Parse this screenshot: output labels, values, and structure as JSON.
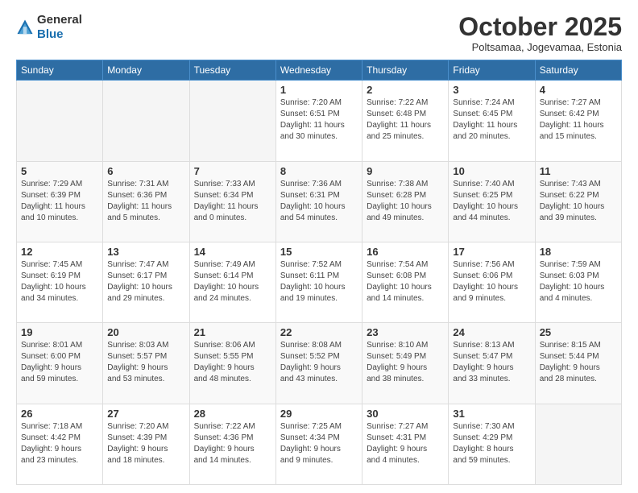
{
  "header": {
    "logo_general": "General",
    "logo_blue": "Blue",
    "month": "October 2025",
    "location": "Poltsamaa, Jogevamaa, Estonia"
  },
  "weekdays": [
    "Sunday",
    "Monday",
    "Tuesday",
    "Wednesday",
    "Thursday",
    "Friday",
    "Saturday"
  ],
  "weeks": [
    [
      {
        "day": "",
        "info": ""
      },
      {
        "day": "",
        "info": ""
      },
      {
        "day": "",
        "info": ""
      },
      {
        "day": "1",
        "info": "Sunrise: 7:20 AM\nSunset: 6:51 PM\nDaylight: 11 hours\nand 30 minutes."
      },
      {
        "day": "2",
        "info": "Sunrise: 7:22 AM\nSunset: 6:48 PM\nDaylight: 11 hours\nand 25 minutes."
      },
      {
        "day": "3",
        "info": "Sunrise: 7:24 AM\nSunset: 6:45 PM\nDaylight: 11 hours\nand 20 minutes."
      },
      {
        "day": "4",
        "info": "Sunrise: 7:27 AM\nSunset: 6:42 PM\nDaylight: 11 hours\nand 15 minutes."
      }
    ],
    [
      {
        "day": "5",
        "info": "Sunrise: 7:29 AM\nSunset: 6:39 PM\nDaylight: 11 hours\nand 10 minutes."
      },
      {
        "day": "6",
        "info": "Sunrise: 7:31 AM\nSunset: 6:36 PM\nDaylight: 11 hours\nand 5 minutes."
      },
      {
        "day": "7",
        "info": "Sunrise: 7:33 AM\nSunset: 6:34 PM\nDaylight: 11 hours\nand 0 minutes."
      },
      {
        "day": "8",
        "info": "Sunrise: 7:36 AM\nSunset: 6:31 PM\nDaylight: 10 hours\nand 54 minutes."
      },
      {
        "day": "9",
        "info": "Sunrise: 7:38 AM\nSunset: 6:28 PM\nDaylight: 10 hours\nand 49 minutes."
      },
      {
        "day": "10",
        "info": "Sunrise: 7:40 AM\nSunset: 6:25 PM\nDaylight: 10 hours\nand 44 minutes."
      },
      {
        "day": "11",
        "info": "Sunrise: 7:43 AM\nSunset: 6:22 PM\nDaylight: 10 hours\nand 39 minutes."
      }
    ],
    [
      {
        "day": "12",
        "info": "Sunrise: 7:45 AM\nSunset: 6:19 PM\nDaylight: 10 hours\nand 34 minutes."
      },
      {
        "day": "13",
        "info": "Sunrise: 7:47 AM\nSunset: 6:17 PM\nDaylight: 10 hours\nand 29 minutes."
      },
      {
        "day": "14",
        "info": "Sunrise: 7:49 AM\nSunset: 6:14 PM\nDaylight: 10 hours\nand 24 minutes."
      },
      {
        "day": "15",
        "info": "Sunrise: 7:52 AM\nSunset: 6:11 PM\nDaylight: 10 hours\nand 19 minutes."
      },
      {
        "day": "16",
        "info": "Sunrise: 7:54 AM\nSunset: 6:08 PM\nDaylight: 10 hours\nand 14 minutes."
      },
      {
        "day": "17",
        "info": "Sunrise: 7:56 AM\nSunset: 6:06 PM\nDaylight: 10 hours\nand 9 minutes."
      },
      {
        "day": "18",
        "info": "Sunrise: 7:59 AM\nSunset: 6:03 PM\nDaylight: 10 hours\nand 4 minutes."
      }
    ],
    [
      {
        "day": "19",
        "info": "Sunrise: 8:01 AM\nSunset: 6:00 PM\nDaylight: 9 hours\nand 59 minutes."
      },
      {
        "day": "20",
        "info": "Sunrise: 8:03 AM\nSunset: 5:57 PM\nDaylight: 9 hours\nand 53 minutes."
      },
      {
        "day": "21",
        "info": "Sunrise: 8:06 AM\nSunset: 5:55 PM\nDaylight: 9 hours\nand 48 minutes."
      },
      {
        "day": "22",
        "info": "Sunrise: 8:08 AM\nSunset: 5:52 PM\nDaylight: 9 hours\nand 43 minutes."
      },
      {
        "day": "23",
        "info": "Sunrise: 8:10 AM\nSunset: 5:49 PM\nDaylight: 9 hours\nand 38 minutes."
      },
      {
        "day": "24",
        "info": "Sunrise: 8:13 AM\nSunset: 5:47 PM\nDaylight: 9 hours\nand 33 minutes."
      },
      {
        "day": "25",
        "info": "Sunrise: 8:15 AM\nSunset: 5:44 PM\nDaylight: 9 hours\nand 28 minutes."
      }
    ],
    [
      {
        "day": "26",
        "info": "Sunrise: 7:18 AM\nSunset: 4:42 PM\nDaylight: 9 hours\nand 23 minutes."
      },
      {
        "day": "27",
        "info": "Sunrise: 7:20 AM\nSunset: 4:39 PM\nDaylight: 9 hours\nand 18 minutes."
      },
      {
        "day": "28",
        "info": "Sunrise: 7:22 AM\nSunset: 4:36 PM\nDaylight: 9 hours\nand 14 minutes."
      },
      {
        "day": "29",
        "info": "Sunrise: 7:25 AM\nSunset: 4:34 PM\nDaylight: 9 hours\nand 9 minutes."
      },
      {
        "day": "30",
        "info": "Sunrise: 7:27 AM\nSunset: 4:31 PM\nDaylight: 9 hours\nand 4 minutes."
      },
      {
        "day": "31",
        "info": "Sunrise: 7:30 AM\nSunset: 4:29 PM\nDaylight: 8 hours\nand 59 minutes."
      },
      {
        "day": "",
        "info": ""
      }
    ]
  ]
}
